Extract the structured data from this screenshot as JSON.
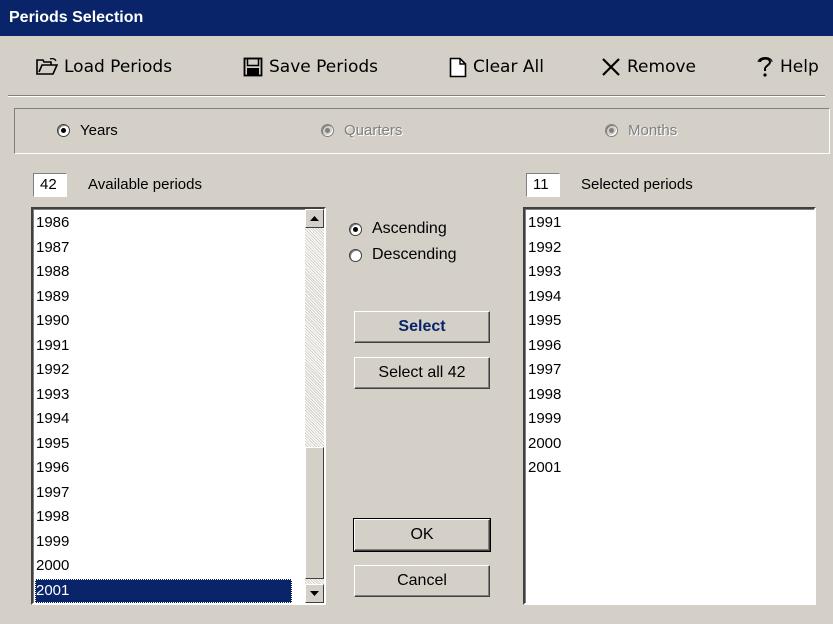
{
  "window": {
    "title": "Periods Selection"
  },
  "toolbar": {
    "load": {
      "label": "Load Periods",
      "icon": "open-folder-icon"
    },
    "save": {
      "label": "Save Periods",
      "icon": "floppy-disk-icon"
    },
    "clear": {
      "label": "Clear All",
      "icon": "blank-page-icon"
    },
    "remove": {
      "label": "Remove",
      "icon": "x-icon"
    },
    "help": {
      "label": "Help",
      "icon": "question-mark-icon"
    }
  },
  "granularity": {
    "years": {
      "label": "Years",
      "checked": true,
      "enabled": true
    },
    "quarters": {
      "label": "Quarters",
      "checked": false,
      "enabled": false
    },
    "months": {
      "label": "Months",
      "checked": false,
      "enabled": false
    }
  },
  "available": {
    "count": "42",
    "label": "Available periods",
    "items": [
      "1986",
      "1987",
      "1988",
      "1989",
      "1990",
      "1991",
      "1992",
      "1993",
      "1994",
      "1995",
      "1996",
      "1997",
      "1998",
      "1999",
      "2000",
      "2001"
    ],
    "selected_item": "2001"
  },
  "sort": {
    "ascending": {
      "label": "Ascending",
      "checked": true
    },
    "descending": {
      "label": "Descending",
      "checked": false
    }
  },
  "buttons": {
    "select": "Select",
    "select_all": "Select all 42",
    "ok": "OK",
    "cancel": "Cancel"
  },
  "selected": {
    "count": "11",
    "label": "Selected periods",
    "items": [
      "1991",
      "1992",
      "1993",
      "1994",
      "1995",
      "1996",
      "1997",
      "1998",
      "1999",
      "2000",
      "2001"
    ]
  },
  "colors": {
    "titlebar": "#0a246a",
    "face": "#d4d0c8",
    "selection": "#0a246a"
  }
}
